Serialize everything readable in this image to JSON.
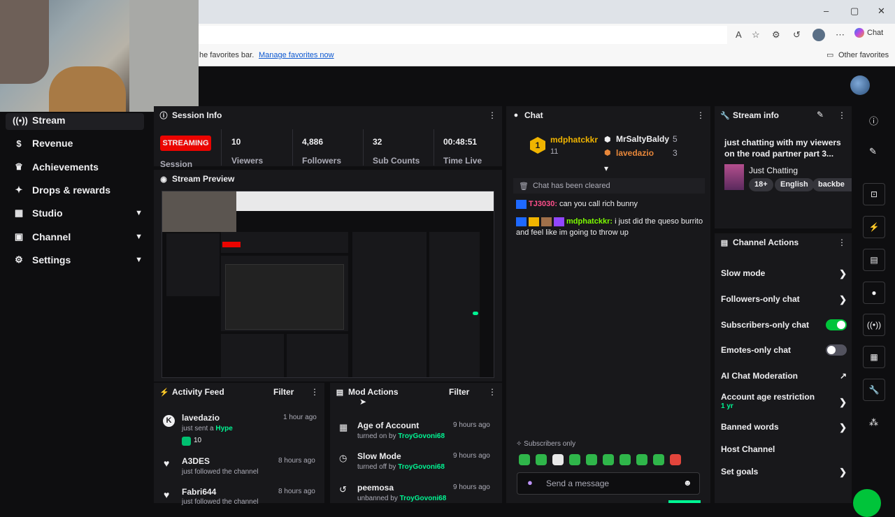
{
  "browser": {
    "favorites_hint": "he favorites bar.",
    "manage_favorites": "Manage favorites now",
    "other_favorites": "Other favorites",
    "chat_button": "Chat",
    "window_min": "–",
    "window_max": "▢",
    "window_close": "✕"
  },
  "sidebar": {
    "items": [
      {
        "label": "Stream",
        "icon": "broadcast-icon"
      },
      {
        "label": "Revenue",
        "icon": "revenue-icon"
      },
      {
        "label": "Achievements",
        "icon": "trophy-icon"
      },
      {
        "label": "Drops & rewards",
        "icon": "gift-icon"
      },
      {
        "label": "Studio",
        "icon": "studio-icon"
      },
      {
        "label": "Channel",
        "icon": "channel-icon"
      },
      {
        "label": "Settings",
        "icon": "gear-icon"
      }
    ]
  },
  "session_info": {
    "title": "Session Info",
    "badge": "STREAMING",
    "session_label": "Session",
    "stats": [
      {
        "value": "10",
        "label": "Viewers"
      },
      {
        "value": "4,886",
        "label": "Followers"
      },
      {
        "value": "32",
        "label": "Sub Counts"
      },
      {
        "value": "00:48:51",
        "label": "Time Live"
      }
    ]
  },
  "stream_preview": {
    "title": "Stream Preview"
  },
  "activity_feed": {
    "title": "Activity Feed",
    "filter": "Filter",
    "items": [
      {
        "name": "lavedazio",
        "sub_prefix": "just sent a ",
        "sub_highlight": "Hype",
        "extra": "10",
        "time": "1 hour ago"
      },
      {
        "name": "A3DES",
        "sub_prefix": "just followed the channel",
        "sub_highlight": "",
        "extra": "",
        "time": "8 hours ago"
      },
      {
        "name": "Fabri644",
        "sub_prefix": "just followed the channel",
        "sub_highlight": "",
        "extra": "",
        "time": "8 hours ago"
      }
    ]
  },
  "mod_actions": {
    "title": "Mod Actions",
    "filter": "Filter",
    "items": [
      {
        "name": "Age of Account",
        "action": "turned on by ",
        "by": "TroyGovoni68",
        "time": "9 hours ago"
      },
      {
        "name": "Slow Mode",
        "action": "turned off by ",
        "by": "TroyGovoni68",
        "time": "9 hours ago"
      },
      {
        "name": "peemosa",
        "action": "unbanned by ",
        "by": "TroyGovoni68",
        "time": "9 hours ago"
      }
    ]
  },
  "chat": {
    "title": "Chat",
    "leaderboard": {
      "first": {
        "rank": "1",
        "name": "mdphatckkr",
        "score": "11"
      },
      "second": {
        "name": "MrSaltyBaldy",
        "score": "5"
      },
      "third": {
        "name": "lavedazio",
        "score": "3"
      }
    },
    "cleared": "Chat has been cleared",
    "messages": [
      {
        "user": "TJ3030",
        "text": "can you call rich bunny"
      },
      {
        "user": "mdphatckkr",
        "text": "i just did the queso burrito and feel like im going to throw up"
      }
    ],
    "mode_note": "Subscribers only",
    "input_placeholder": "Send a message"
  },
  "stream_info": {
    "title": "Stream info",
    "stream_title": "just chatting with my viewers on the road partner part 3...",
    "category": "Just Chatting",
    "tags": [
      "18+",
      "English",
      "backbe"
    ]
  },
  "channel_actions": {
    "title": "Channel Actions",
    "items": [
      {
        "label": "Slow mode",
        "control": "chevron"
      },
      {
        "label": "Followers-only chat",
        "control": "chevron"
      },
      {
        "label": "Subscribers-only chat",
        "control": "toggle-on"
      },
      {
        "label": "Emotes-only chat",
        "control": "toggle-off"
      },
      {
        "label": "AI Chat Moderation",
        "control": "external"
      },
      {
        "label": "Account age restriction",
        "sub": "1 yr",
        "control": "chevron"
      },
      {
        "label": "Banned words",
        "control": "chevron"
      },
      {
        "label": "Host Channel",
        "control": "none"
      },
      {
        "label": "Set goals",
        "control": "chevron"
      }
    ]
  },
  "colors": {
    "accent_green": "#00f593",
    "streaming_red": "#eb0400",
    "username_pink": "#ff4f8b",
    "username_green": "#7cfc00",
    "panel_bg": "#18181b"
  }
}
